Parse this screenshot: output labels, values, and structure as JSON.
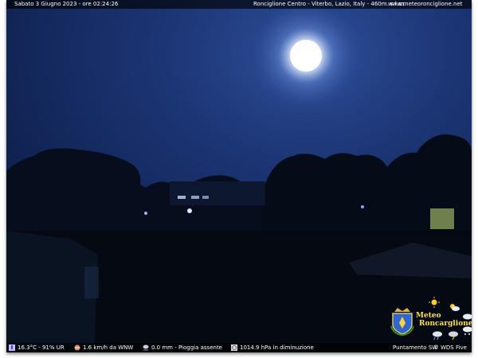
{
  "overlay_top": {
    "datetime": "Sabato 3 Giugno 2023 - ore 02:24:26",
    "location": "Ronciglione Centro - Viterbo, Lazio, Italy - 460m. s.l.m.",
    "website": "www.meteoronciglione.net"
  },
  "overlay_bottom": {
    "temperature_humidity": "16.3°C - 91% UR",
    "wind": "1.6 km/h da WNW",
    "rain": "0.0 mm - Pioggia assente",
    "pressure": "1014.9 hPa in diminuzione",
    "camera_direction": "Puntamento SW",
    "camera_model": "WDS Five"
  },
  "logo": {
    "line1": "Meteo",
    "line2": "Roncarglione"
  },
  "colors": {
    "sky": "#1a3370",
    "moon": "#ffffff",
    "logo_text": "#ffe24a"
  }
}
